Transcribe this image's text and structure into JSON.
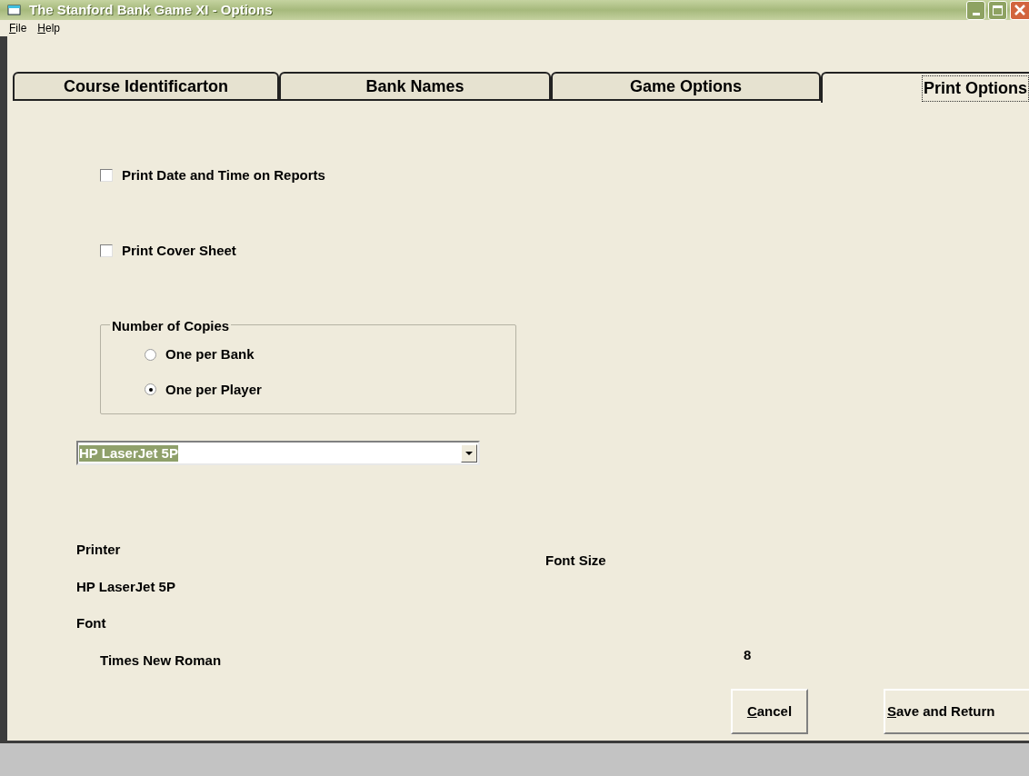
{
  "window": {
    "title": "The Stanford Bank Game XI - Options"
  },
  "menu": [
    {
      "accel": "F",
      "rest": "ile"
    },
    {
      "accel": "H",
      "rest": "elp"
    }
  ],
  "tabs": [
    {
      "label": "Course Identificarton",
      "selected": false
    },
    {
      "label": "Bank Names",
      "selected": false
    },
    {
      "label": "Game Options",
      "selected": false
    },
    {
      "label": "Print Options",
      "selected": true
    }
  ],
  "checkboxes": [
    {
      "label": "Print Date and Time on Reports",
      "checked": false
    },
    {
      "label": "Print Cover Sheet",
      "checked": false
    }
  ],
  "copies_group": {
    "title": "Number of Copies",
    "options": [
      {
        "label": "One per Bank",
        "selected": false
      },
      {
        "label": "One per Player",
        "selected": true
      }
    ]
  },
  "printer_dropdown": {
    "value": "HP LaserJet 5P"
  },
  "info": {
    "printer_label": "Printer",
    "printer_name": "HP LaserJet 5P",
    "font_label": "Font",
    "font_name": "Times New Roman",
    "font_size_label": "Font Size",
    "font_size": "8"
  },
  "buttons": [
    {
      "accel": "C",
      "rest": "ancel"
    },
    {
      "accel": "S",
      "rest": "ave and Return"
    }
  ]
}
